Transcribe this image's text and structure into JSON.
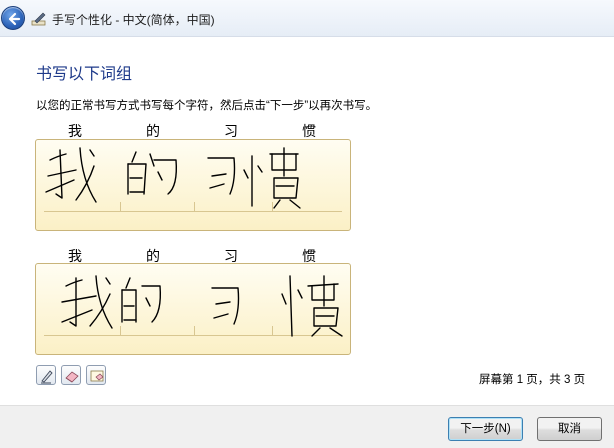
{
  "window": {
    "title": "手写个性化 - 中文(简体，中国)",
    "back_icon": "back-arrow-icon",
    "app_icon": "pen-icon"
  },
  "main": {
    "heading": "书写以下词组",
    "instruction": "以您的正常书写方式书写每个字符，然后点击“下一步”以再次书写。",
    "rows": [
      {
        "characters": [
          "我",
          "的",
          "习",
          "惯"
        ]
      },
      {
        "characters": [
          "我",
          "的",
          "习",
          "惯"
        ]
      }
    ]
  },
  "tools": [
    {
      "name": "pen-tool",
      "icon": "pen-icon"
    },
    {
      "name": "eraser-tool",
      "icon": "eraser-icon"
    },
    {
      "name": "clear-tool",
      "icon": "clear-ink-icon"
    }
  ],
  "page_indicator": "屏幕第 1 页，共 3 页",
  "footer": {
    "next_label": "下一步(N)",
    "cancel_label": "取消"
  },
  "colors": {
    "heading": "#1e3a8a",
    "pad_top": "#fffdf2",
    "pad_bottom": "#fbf0c6",
    "ink": "#000000"
  }
}
